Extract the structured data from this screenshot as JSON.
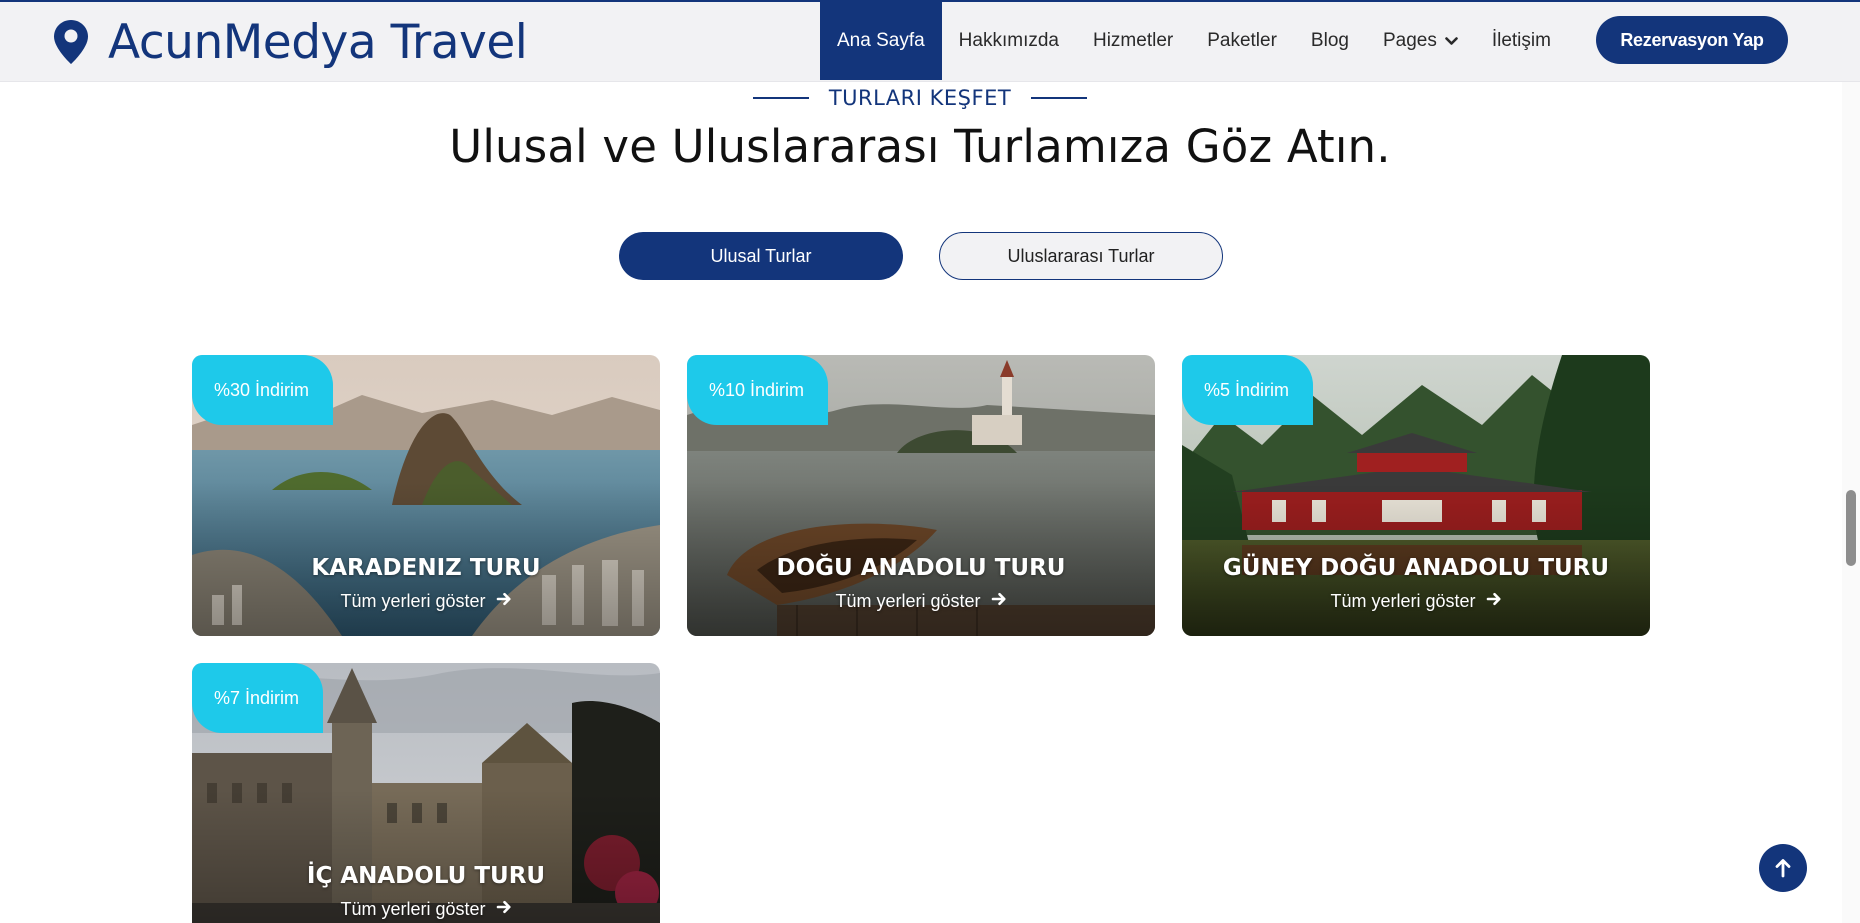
{
  "brand": {
    "name": "AcunMedya Travel"
  },
  "nav": {
    "items": [
      {
        "label": "Ana Sayfa"
      },
      {
        "label": "Hakkımızda"
      },
      {
        "label": "Hizmetler"
      },
      {
        "label": "Paketler"
      },
      {
        "label": "Blog"
      },
      {
        "label": "Pages"
      },
      {
        "label": "İletişim"
      }
    ],
    "cta": "Rezervasyon Yap"
  },
  "section": {
    "eyebrow": "TURLARI KEŞFET",
    "title": "Ulusal ve Uluslararası Turlamıza Göz Atın."
  },
  "tabs": [
    {
      "label": "Ulusal Turlar"
    },
    {
      "label": "Uluslararası Turlar"
    }
  ],
  "tours": [
    {
      "badge": "%30 İndirim",
      "title": "KARADENIZ TURU",
      "link": "Tüm yerleri göster"
    },
    {
      "badge": "%10 İndirim",
      "title": "DOĞU ANADOLU TURU",
      "link": "Tüm yerleri göster"
    },
    {
      "badge": "%5 İndirim",
      "title": "GÜNEY DOĞU ANADOLU TURU",
      "link": "Tüm yerleri göster"
    },
    {
      "badge": "%7 İndirim",
      "title": "İÇ ANADOLU TURU",
      "link": "Tüm yerleri göster"
    }
  ],
  "colors": {
    "primary": "#13357B",
    "accent": "#1EC9EA"
  },
  "icons": [
    "map-pin-icon",
    "chevron-down-icon",
    "arrow-right-icon",
    "arrow-up-icon"
  ]
}
